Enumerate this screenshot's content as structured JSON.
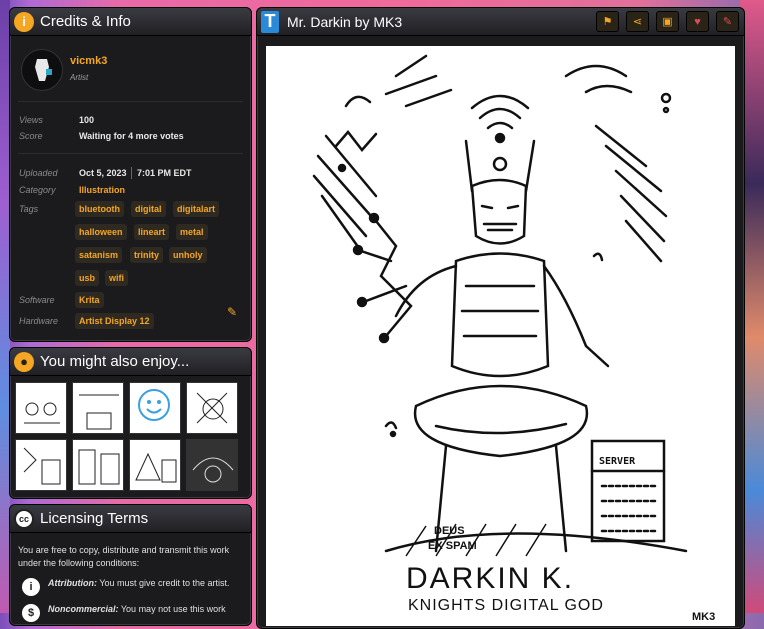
{
  "credits": {
    "title": "Credits & Info",
    "artist_name": "vicmk3",
    "artist_role": "Artist",
    "views_label": "Views",
    "views_value": "100",
    "score_label": "Score",
    "score_value": "Waiting for 4 more votes",
    "uploaded_label": "Uploaded",
    "uploaded_date": "Oct 5, 2023",
    "uploaded_time": "7:01 PM EDT",
    "category_label": "Category",
    "category_value": "Illustration",
    "tags_label": "Tags",
    "tags": [
      "bluetooth",
      "digital",
      "digitalart",
      "halloween",
      "lineart",
      "metal",
      "satanism",
      "trinity",
      "unholy",
      "usb",
      "wifi"
    ],
    "software_label": "Software",
    "software_value": "Krita",
    "hardware_label": "Hardware",
    "hardware_value": "Artist Display 12"
  },
  "recommend": {
    "title": "You might also enjoy..."
  },
  "licensing": {
    "title": "Licensing Terms",
    "intro": "You are free to copy, distribute and transmit this work under the following conditions:",
    "attribution_term": "Attribution:",
    "attribution_text": "You must give credit to the artist.",
    "noncommercial_term": "Noncommercial:",
    "noncommercial_text": "You may not use this work"
  },
  "artwork": {
    "title": "Mr. Darkin by MK3",
    "caption_main": "DARKIN K.",
    "caption_sub": "KNIGHTS DIGITAL GOD",
    "caption_deus": "DEUS",
    "caption_spam": "EX SPAM",
    "server_label": "SERVER",
    "signature": "MK3"
  },
  "colors": {
    "accent": "#f5a623",
    "panel": "#1b1b1e"
  }
}
